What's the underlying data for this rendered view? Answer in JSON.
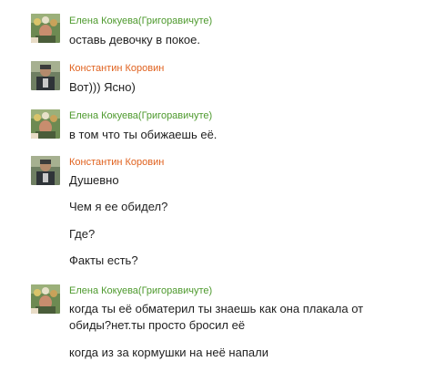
{
  "messages": [
    {
      "author": "Елена Кокуева(Григоравичуте)",
      "author_color": "#4e9a2e",
      "avatar_icon": "avatar-flowers-icon",
      "lines": [
        "оставь девочку в покое."
      ]
    },
    {
      "author": "Константин Коровин",
      "author_color": "#e0621f",
      "avatar_icon": "avatar-man-icon",
      "lines": [
        "Вот))) Ясно)"
      ]
    },
    {
      "author": "Елена Кокуева(Григоравичуте)",
      "author_color": "#4e9a2e",
      "avatar_icon": "avatar-flowers-icon",
      "lines": [
        "в том что ты обижаешь её."
      ]
    },
    {
      "author": "Константин Коровин",
      "author_color": "#e0621f",
      "avatar_icon": "avatar-man-icon",
      "lines": [
        "Душевно",
        "Чем я ее обидел?",
        "Где?",
        "Факты есть?"
      ]
    },
    {
      "author": "Елена Кокуева(Григоравичуте)",
      "author_color": "#4e9a2e",
      "avatar_icon": "avatar-flowers-icon",
      "lines": [
        "когда ты её обматерил ты знаешь как она плакала от",
        "обиды?нет.ты просто бросил её",
        "когда из за кормушки на неё напали"
      ]
    }
  ]
}
